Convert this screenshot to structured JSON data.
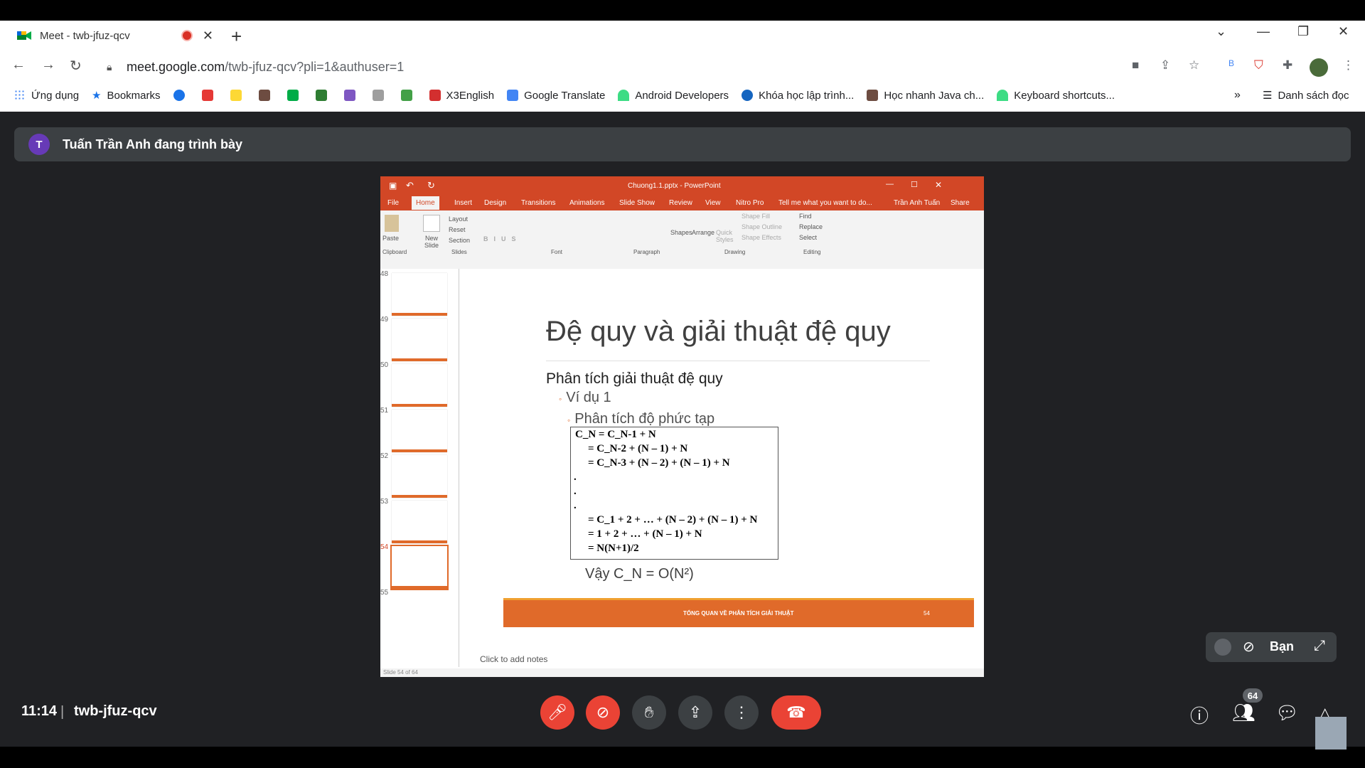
{
  "browser": {
    "tab_title": "Meet - twb-jfuz-qcv",
    "url_host": "meet.google.com",
    "url_path": "/twb-jfuz-qcv?pli=1&authuser=1",
    "bookmarks": [
      "Ứng dụng",
      "Bookmarks",
      "X3English",
      "Google Translate",
      "Android Developers",
      "Khóa học lập trình...",
      "Học nhanh Java ch...",
      "Keyboard shortcuts..."
    ],
    "reading_list": "Danh sách đọc",
    "more": "»"
  },
  "meet": {
    "presenter_initial": "T",
    "presenter_text": "Tuấn Trần Anh đang trình bày",
    "time": "11:14",
    "meeting_code": "twb-jfuz-qcv",
    "self_label": "Bạn",
    "participants_count": "64"
  },
  "ppt": {
    "window_title": "Chuong1.1.pptx - PowerPoint",
    "tabs": [
      "File",
      "Home",
      "Insert",
      "Design",
      "Transitions",
      "Animations",
      "Slide Show",
      "Review",
      "View",
      "Nitro Pro",
      "Tell me what you want to do...",
      "Trần Anh Tuấn",
      "Share"
    ],
    "ribbon": {
      "paste": "Paste",
      "new_slide": "New Slide",
      "layout": "Layout",
      "reset": "Reset",
      "section": "Section",
      "shapes": "Shapes",
      "arrange": "Arrange",
      "quick_styles": "Quick Styles",
      "shape_fill": "Shape Fill",
      "shape_outline": "Shape Outline",
      "shape_effects": "Shape Effects",
      "find": "Find",
      "replace": "Replace",
      "select": "Select",
      "groups": [
        "Clipboard",
        "Slides",
        "Font",
        "Paragraph",
        "Drawing",
        "Editing"
      ]
    },
    "thumb_numbers": [
      "48",
      "49",
      "50",
      "51",
      "52",
      "53",
      "54",
      "55"
    ],
    "slide": {
      "title": "Đệ quy và giải thuật đệ quy",
      "heading": "Phân tích giải thuật đệ quy",
      "bullet1": "Ví dụ 1",
      "bullet2": "Phân tích độ phức tạp",
      "formula": [
        "C_N = C_N-1 + N",
        "= C_N-2 + (N – 1) + N",
        "= C_N-3 + (N – 2) + (N – 1) + N",
        ".",
        ".",
        ".",
        "= C_1 + 2 + … + (N – 2) + (N – 1) + N",
        "= 1 + 2 + … + (N – 1) + N",
        "= N(N+1)/2"
      ],
      "conclusion": "Vậy C_N = O(N²)",
      "footer": "TỔNG QUAN VỀ PHÂN TÍCH GIẢI THUẬT",
      "page_number": "54"
    },
    "notes_placeholder": "Click to add notes",
    "status": "Slide 54 of 64"
  }
}
